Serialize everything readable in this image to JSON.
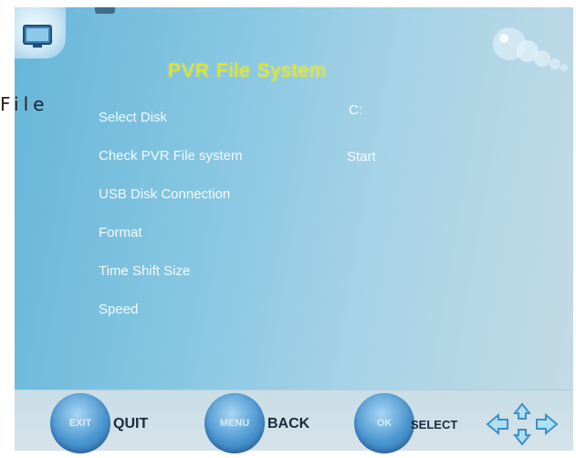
{
  "menu": {
    "title": "PVR File System",
    "side_label": "File",
    "items": [
      {
        "label": "Select Disk",
        "value": "C:"
      },
      {
        "label": "Check PVR File system",
        "value": "Start"
      },
      {
        "label": "USB Disk Connection",
        "value": ""
      },
      {
        "label": "Format",
        "value": ""
      },
      {
        "label": "Time Shift Size",
        "value": ""
      },
      {
        "label": "Speed",
        "value": ""
      }
    ]
  },
  "footer": {
    "exit": {
      "key": "EXIT",
      "label": "QUIT"
    },
    "menu": {
      "key": "MENU",
      "label": "BACK"
    },
    "ok": {
      "key": "OK",
      "label": "SELECT"
    }
  },
  "colors": {
    "title": "#f0e600",
    "screen_start": "#66b6d8",
    "screen_end": "#c3dbe5",
    "button": "#4a95cf"
  },
  "icons": [
    "tv-icon",
    "bubbles-icon",
    "navigation-arrows-icon"
  ]
}
